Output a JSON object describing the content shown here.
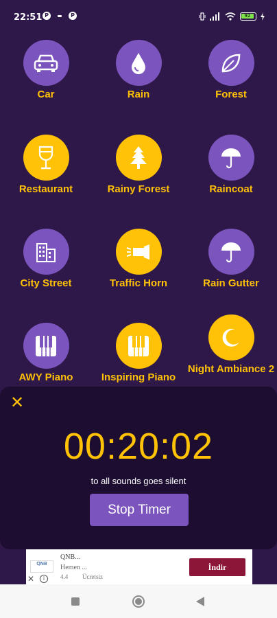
{
  "status_bar": {
    "time": "22:51",
    "battery_label": "92"
  },
  "sounds": [
    {
      "label": "Car",
      "icon": "car-icon",
      "style": "purple"
    },
    {
      "label": "Rain",
      "icon": "raindrop-icon",
      "style": "purple"
    },
    {
      "label": "Forest",
      "icon": "leaf-icon",
      "style": "purple"
    },
    {
      "label": "Restaurant",
      "icon": "wine-glass-icon",
      "style": "yellow"
    },
    {
      "label": "Rainy Forest",
      "icon": "pine-tree-icon",
      "style": "yellow"
    },
    {
      "label": "Raincoat",
      "icon": "umbrella-icon",
      "style": "purple"
    },
    {
      "label": "City Street",
      "icon": "building-icon",
      "style": "purple"
    },
    {
      "label": "Traffic Horn",
      "icon": "horn-icon",
      "style": "yellow"
    },
    {
      "label": "Rain Gutter",
      "icon": "umbrella-icon",
      "style": "purple"
    },
    {
      "label": "AWY Piano",
      "icon": "piano-icon",
      "style": "purple"
    },
    {
      "label": "Inspiring Piano",
      "icon": "piano-icon",
      "style": "yellow"
    },
    {
      "label": "Night Ambiance 2",
      "icon": "moon-icon",
      "style": "yellow"
    }
  ],
  "timer": {
    "close_label": "✕",
    "value": "00:20:02",
    "caption": "to all sounds goes silent",
    "stop_label": "Stop Timer"
  },
  "ad": {
    "logo_text": "QNB",
    "title": "QNB...",
    "subtitle": "Hemen ...",
    "rating": "4.4",
    "price": "Ücretsiz",
    "install_label": "İndir",
    "close_label": "✕",
    "info_label": "i"
  },
  "colors": {
    "background": "#2e1749",
    "accent": "#ffc206",
    "purple": "#7b55bd",
    "panel": "#1d0e31"
  }
}
